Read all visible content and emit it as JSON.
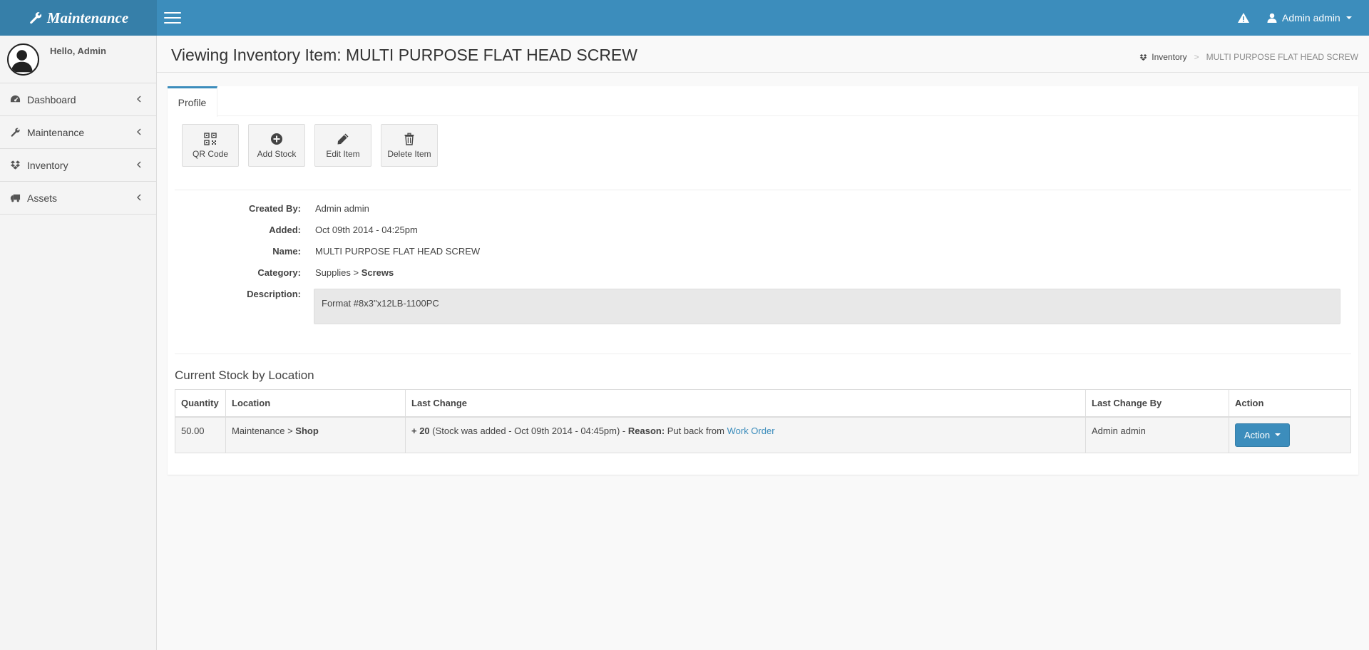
{
  "header": {
    "brand": "Maintenance",
    "user_menu_label": "Admin admin"
  },
  "sidebar": {
    "greeting": "Hello, Admin",
    "items": [
      {
        "label": "Dashboard",
        "icon": "dashboard-icon"
      },
      {
        "label": "Maintenance",
        "icon": "wrench-icon"
      },
      {
        "label": "Inventory",
        "icon": "dropbox-icon"
      },
      {
        "label": "Assets",
        "icon": "truck-icon"
      }
    ]
  },
  "page": {
    "title": "Viewing Inventory Item: MULTI PURPOSE FLAT HEAD SCREW",
    "breadcrumb": {
      "parent": "Inventory",
      "separator": ">",
      "current": "MULTI PURPOSE FLAT HEAD SCREW"
    },
    "tabs": [
      {
        "label": "Profile",
        "active": true
      }
    ]
  },
  "toolbar": {
    "qr_label": "QR Code",
    "add_stock_label": "Add Stock",
    "edit_label": "Edit Item",
    "delete_label": "Delete Item"
  },
  "details": {
    "created_by_label": "Created By:",
    "created_by": "Admin admin",
    "added_label": "Added:",
    "added": "Oct 09th 2014 - 04:25pm",
    "name_label": "Name:",
    "name": "MULTI PURPOSE FLAT HEAD SCREW",
    "category_label": "Category:",
    "category_parent": "Supplies",
    "category_sep": " > ",
    "category_child": "Screws",
    "description_label": "Description:",
    "description": "Format #8x3\"x12LB-1100PC"
  },
  "stock": {
    "section_title": "Current Stock by Location",
    "columns": [
      "Quantity",
      "Location",
      "Last Change",
      "Last Change By",
      "Action"
    ],
    "rows": [
      {
        "quantity": "50.00",
        "location_parent": "Maintenance",
        "location_sep": " > ",
        "location_child": "Shop",
        "change_amount": "+ 20",
        "change_text": " (Stock was added - Oct 09th 2014 - 04:45pm) - ",
        "reason_label": "Reason:",
        "reason_text": " Put back from ",
        "reason_link": "Work Order",
        "changed_by": "Admin admin",
        "action_label": "Action"
      }
    ]
  },
  "colors": {
    "topbar": "#3c8dbc",
    "logo_bg": "#367fa9",
    "accent": "#3c8dbc"
  }
}
